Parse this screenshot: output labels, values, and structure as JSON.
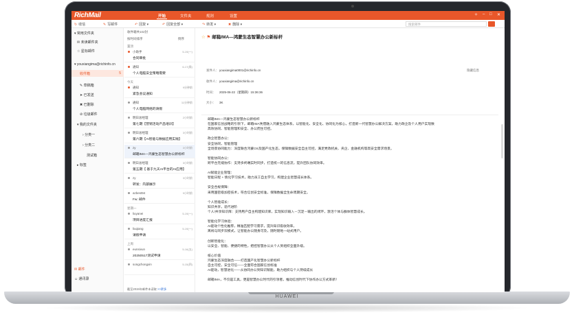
{
  "device": {
    "brand": "HUAWEI"
  },
  "app": {
    "logo": "RichMail",
    "tabs": [
      {
        "label": "开始",
        "active": true
      },
      {
        "label": "文件夹",
        "active": false
      },
      {
        "label": "规则",
        "active": false
      },
      {
        "label": "设置",
        "active": false
      }
    ],
    "accent": "#e8572a"
  },
  "toolbar": {
    "receive": "收信",
    "compose": "写邮件",
    "reply": "回复",
    "reply_all": "回复全部",
    "forward": "转发",
    "delete": "删除",
    "search_placeholder": "搜索邮件"
  },
  "sidebar": {
    "common": "常用文件夹",
    "unread": "未读邮件夹",
    "starred": "星标邮件",
    "account": "youxiangima@richinfo.cn",
    "inbox": "收件箱",
    "inbox_count": "5",
    "drafts": "草稿箱",
    "sent": "已发送",
    "deleted": "已删除",
    "spam": "垃圾邮件",
    "my_folders": "我的文件夹",
    "cat1": "分类一",
    "cat2": "分类二",
    "test": "测试箱",
    "tags": "标签",
    "mail_label": "邮件",
    "contacts_label": "通讯录"
  },
  "list": {
    "header": "收件箱共102封",
    "sort": "按时间排序",
    "order": "倒序",
    "groups": [
      "置顶",
      "今天",
      "星期一",
      "上周"
    ],
    "items": [
      {
        "sender": "小助手",
        "time": "5-19(一)",
        "subject": "合同审批",
        "dot": "#e8572a"
      },
      {
        "sender": "通知",
        "time": "6-17(周)",
        "subject": "个人电脑安全策略需要",
        "dot": "#e8572a"
      },
      {
        "sender": "通知",
        "time": "9分钟前",
        "subject": "紧急会议通知",
        "dot": "#e8572a"
      },
      {
        "sender": "通知",
        "time": "11分钟前",
        "subject": "个人电脑网络的请假",
        "dot": "#999"
      },
      {
        "sender": "明日总经理",
        "time": "2小时前",
        "subject": "第七期【营销活动产品培训】",
        "dot": "#999"
      },
      {
        "sender": "明日总经理",
        "time": "3小时前",
        "subject": "第六期【AI智能与数据应用实践】",
        "dot": "#999"
      },
      {
        "sender": "zy",
        "time": "3小时前",
        "subject": "邮箱IMA—鸿蒙生态智慧办公新标杆",
        "dot": "#999",
        "selected": true
      },
      {
        "sender": "明日总经理",
        "time": "3小时前",
        "subject": "第五期【 基于九天AI平台的AI应用】",
        "dot": "#999"
      },
      {
        "sender": "zy",
        "time": "3小时前",
        "subject": "转发：内部展示",
        "dot": "#999"
      },
      {
        "sender": "azbest94",
        "time": "9小时前",
        "subject": "Fw: 邮件",
        "dot": "#999"
      },
      {
        "sender": "liuyanei",
        "time": "5-19(一)",
        "subject": "项目进度汇报",
        "dot": "#999"
      },
      {
        "sender": "liuqiang",
        "time": "5-19(一)",
        "subject": "请假申请",
        "dot": "#999"
      },
      {
        "sender": "eunsivun",
        "time": "5-16(五)",
        "subject": "20250517测试申请",
        "dot": "#999"
      },
      {
        "sender": "songchongxin",
        "time": "5-15(四)",
        "subject": "",
        "dot": "#999"
      }
    ],
    "footer": "截至2015年邮件未读取",
    "footer_more": ">>更多"
  },
  "reading": {
    "subject": "邮箱IMA—鸿蒙生态智慧办公新标杆",
    "hide_details": "隐藏信息",
    "sender_label": "发件人：",
    "sender": "youxiangima0001@richinfo.cn",
    "recipient_label": "收件人：",
    "recipient": "youxiangima@richinfo.cn",
    "time_label": "时间：",
    "time": "2025-06-22（星期四）15:36:36",
    "size_label": "大小：",
    "size": "3K",
    "body": [
      "邮箱IMA—鸿蒙生态智慧办公新标杆",
      "在国家信创战略的引领下，邮箱IMA凭借融入鸿蒙生态体系，以智能化、安全化、协同化为核心，打造新一代智慧办公解决方案，助力政企及个人用户实现数",
      "高效协同、智能管理和安全、办公而生可控。",
      "",
      "政企智慧办公：",
      "安全协同，智能管理",
      "全场景协同能力：深度联合鸿蒙OS及国产化生态，保障数据安全自主可控，满足党政机关、央企、金融机构等高安全需求场景。",
      "",
      "智能协同办公：",
      "跨平台无缝协作：支持多终端实时同步，打造统一的信息流，提升团队协同效率。",
      "",
      "AI赋能企业管理：",
      "智能日程 + 情化学习技术，助力员工自主学习，构建企业智慧成长体系。",
      "",
      "安全合规保障：",
      "采用国密级加密技术，符合信创安全标准，保障数据全生命周期安全。",
      "",
      "个人智能成长：",
      "知识共享，迭代进阶",
      "个人/共享知识库：支持用户自主构建知识库，实现知识输入－沉淀－输出的闭环，激活个体与群体智慧成长。",
      "",
      "智能化学习体验：",
      "AI驱动个性化推荐，精准匹配学习需求，提升知识吸收效率。",
      "离线与同步双模式，让智能办公随身可及，随时随地一站式用户。",
      "",
      "创新智能化：",
      "以安全、智能、便捷的特性，把控智慧办公从个人到组织全面升级。",
      "",
      "核心价值",
      "鸿蒙生态深度融合——打造国产化智慧办公新标杆",
      "自主可控，安全可信——全面符合国家信创标准",
      "AI驱动，智慧进化——从协同办公到知识赋能，助力组织与个人持续成长",
      "",
      "邮箱IMA，不仅是工具，更是智慧办公时代的引领者，推动信创时代下协作办公方式革新！"
    ]
  }
}
